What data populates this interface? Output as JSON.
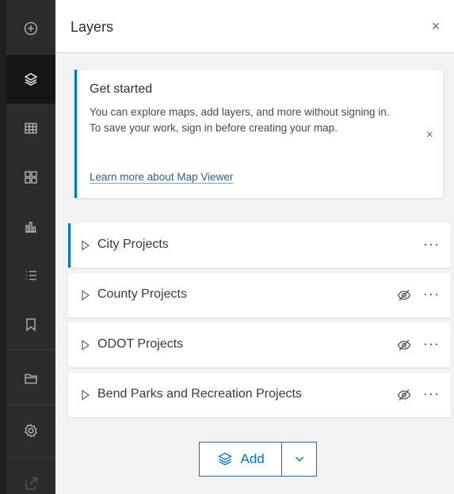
{
  "actionbar": {
    "items": [
      {
        "icon": "add-circle-icon"
      },
      {
        "icon": "layers-icon",
        "active": true
      },
      {
        "icon": "table-icon"
      },
      {
        "icon": "widgets-icon"
      },
      {
        "icon": "bar-chart-icon"
      },
      {
        "icon": "legend-list-icon"
      },
      {
        "icon": "bookmark-icon"
      },
      {
        "icon": "folder-icon"
      },
      {
        "icon": "settings-gear-icon"
      },
      {
        "icon": "share-icon",
        "disabled": true
      }
    ]
  },
  "panel": {
    "title": "Layers",
    "close_glyph": "×"
  },
  "notice": {
    "title": "Get started",
    "message": "You can explore maps, add layers, and more without signing in. To save your work, sign in before creating your map.",
    "link": "Learn more about Map Viewer",
    "close_glyph": "×"
  },
  "layers": [
    {
      "label": "City Projects",
      "selected": true,
      "hidden": false
    },
    {
      "label": "County Projects",
      "selected": false,
      "hidden": true
    },
    {
      "label": "ODOT Projects",
      "selected": false,
      "hidden": true
    },
    {
      "label": "Bend Parks and Recreation Projects",
      "selected": false,
      "hidden": true
    }
  ],
  "more_glyph": "···",
  "add_button": {
    "label": "Add"
  },
  "colors": {
    "accent": "#0079c1",
    "actionbar_bg": "#2b2b2b",
    "panel_bg": "#f3f3f3"
  }
}
